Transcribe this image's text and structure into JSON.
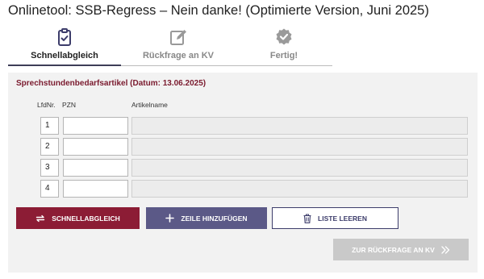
{
  "page": {
    "title": "Onlinetool: SSB-Regress – Nein danke! (Optimierte Version, Juni 2025)"
  },
  "steps": [
    {
      "label": "Schnellabgleich",
      "icon": "clipboard-check-icon",
      "active": true
    },
    {
      "label": "Rückfrage an KV",
      "icon": "edit-icon",
      "active": false
    },
    {
      "label": "Fertig!",
      "icon": "check-badge-icon",
      "active": false
    }
  ],
  "form": {
    "section_title": "Sprechstundenbedarfsartikel (Datum: 13.06.2025)",
    "columns": {
      "lfd": "LfdNr.",
      "pzn": "PZN",
      "article": "Artikelname"
    },
    "rows": [
      {
        "num": "1",
        "pzn": "",
        "article": ""
      },
      {
        "num": "2",
        "pzn": "",
        "article": ""
      },
      {
        "num": "3",
        "pzn": "",
        "article": ""
      },
      {
        "num": "4",
        "pzn": "",
        "article": ""
      }
    ]
  },
  "actions": {
    "sync_label": "SCHNELLABGLEICH",
    "add_row_label": "ZEILE HINZUFÜGEN",
    "clear_label": "LISTE LEEREN",
    "next_label": "ZUR RÜCKFRAGE AN KV"
  },
  "colors": {
    "primary": "#8c1c35",
    "secondary": "#5b5987",
    "outline": "#3d3d6b",
    "disabled": "#c9c9c9",
    "section_title": "#7a1a2e"
  }
}
